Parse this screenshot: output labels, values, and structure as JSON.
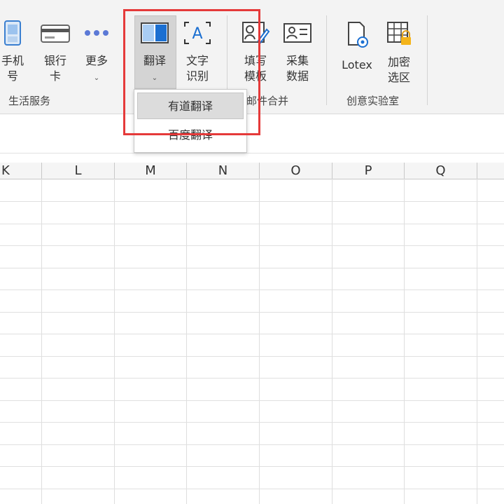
{
  "ribbon": {
    "buttons": {
      "phone": "手机\n号",
      "bank": "银行\n卡",
      "more": "更多",
      "translate": "翻译",
      "ocr": "文字\n识别",
      "fill_template": "填写\n模板",
      "collect_data": "采集\n数据",
      "lotex": "Lotex",
      "encrypt": "加密\n选区"
    },
    "groups": {
      "life": "生活服务",
      "mail_merge": "邮件合并",
      "lab": "创意实验室"
    },
    "ocr_icon_letter": "A"
  },
  "translate_menu": {
    "items": [
      "有道翻译",
      "百度翻译"
    ]
  },
  "grid": {
    "columns": [
      "K",
      "L",
      "M",
      "N",
      "O",
      "P",
      "Q"
    ]
  },
  "colors": {
    "highlight": "#e53a3a",
    "accent_blue": "#1b6fd1"
  }
}
